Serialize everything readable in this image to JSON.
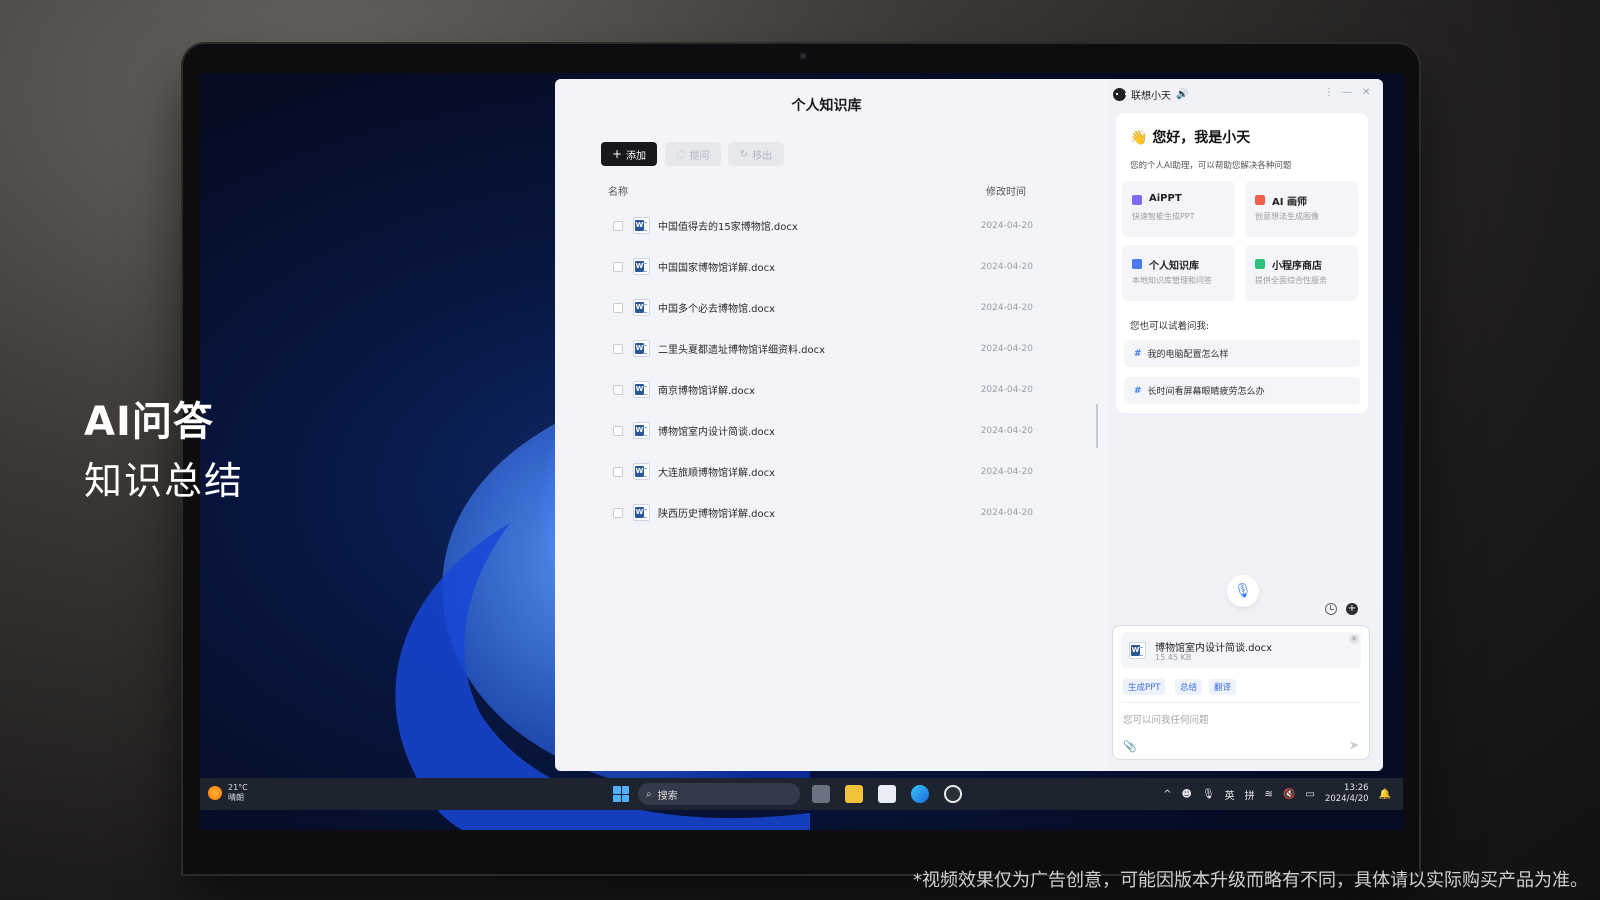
{
  "overlay": {
    "title": "AI问答",
    "subtitle": "知识总结",
    "disclaimer": "*视频效果仅为广告创意，可能因版本升级而略有不同，具体请以实际购买产品为准。"
  },
  "knowledge_base": {
    "title": "个人知识库",
    "add_label": "添加",
    "ask_label": "提问",
    "remove_label": "移出",
    "col_name": "名称",
    "col_modified": "修改时间",
    "files": [
      {
        "name": "中国值得去的15家博物馆.docx",
        "date": "2024-04-20"
      },
      {
        "name": "中国国家博物馆详解.docx",
        "date": "2024-04-20"
      },
      {
        "name": "中国多个必去博物馆.docx",
        "date": "2024-04-20"
      },
      {
        "name": "二里头夏都遗址博物馆详细资料.docx",
        "date": "2024-04-20"
      },
      {
        "name": "南京博物馆详解.docx",
        "date": "2024-04-20"
      },
      {
        "name": "博物馆室内设计简谈.docx",
        "date": "2024-04-20"
      },
      {
        "name": "大连旅顺博物馆详解.docx",
        "date": "2024-04-20"
      },
      {
        "name": "陕西历史博物馆详解.docx",
        "date": "2024-04-20"
      }
    ]
  },
  "assistant": {
    "name": "联想小天",
    "greeting": "您好，我是小天",
    "greeting_sub": "您的个人AI助理，可以帮助您解决各种问题",
    "tiles": [
      {
        "title": "AiPPT",
        "sub": "快速智能生成PPT",
        "color": "#7b6cf6"
      },
      {
        "title": "AI 画师",
        "sub": "创意想法生成图像",
        "color": "#f0604d"
      },
      {
        "title": "个人知识库",
        "sub": "本地知识库管理和问答",
        "color": "#4a7cf0"
      },
      {
        "title": "小程序商店",
        "sub": "提供全面综合性服务",
        "color": "#2fbf7a"
      }
    ],
    "try_label": "您也可以试着问我:",
    "suggestions": [
      "我的电脑配置怎么样",
      "长时间看屏幕眼睛疲劳怎么办"
    ],
    "attachment": {
      "name": "博物馆室内设计简谈.docx",
      "size": "15.45 KB"
    },
    "chips": [
      "生成PPT",
      "总结",
      "翻译"
    ],
    "input_placeholder": "您可以问我任何问题"
  },
  "taskbar": {
    "temp": "21°C",
    "weather": "晴朗",
    "search_label": "搜索",
    "ime_en": "英",
    "ime_pinyin": "拼",
    "time": "13:26",
    "date": "2024/4/20"
  }
}
